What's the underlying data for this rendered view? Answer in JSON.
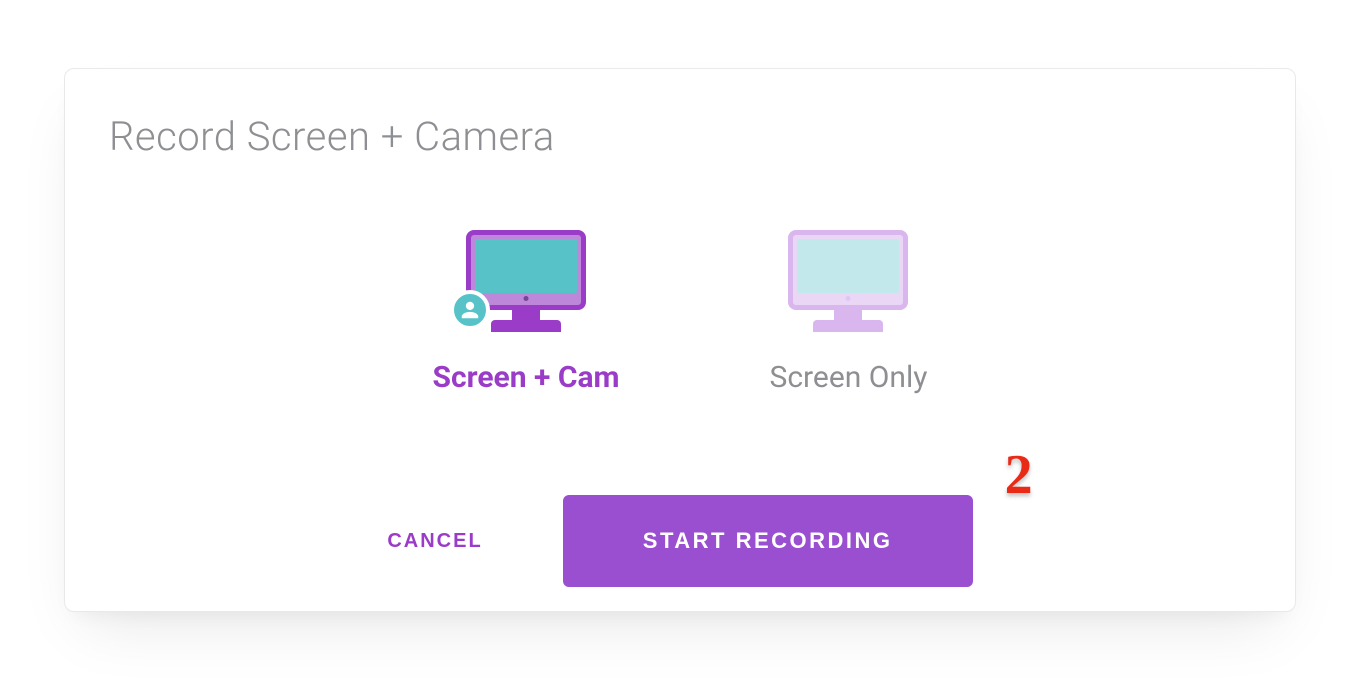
{
  "title": "Record Screen + Camera",
  "options": {
    "screen_cam": {
      "label": "Screen + Cam",
      "selected": true
    },
    "screen_only": {
      "label": "Screen Only",
      "selected": false
    }
  },
  "actions": {
    "cancel_label": "CANCEL",
    "start_label": "START RECORDING"
  },
  "annotation": {
    "step": "2"
  },
  "colors": {
    "accent": "#9a3cc8",
    "accent_fill": "#9a4fd1",
    "teal": "#57c3c9",
    "muted_text": "#8d8f93",
    "annotation_red": "#e82a17"
  }
}
